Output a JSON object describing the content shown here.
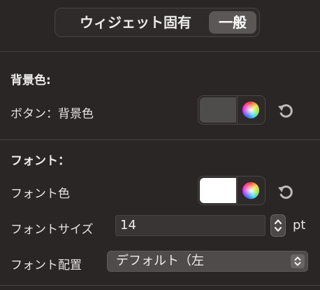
{
  "tabs": {
    "items": [
      {
        "label": "ウィジェット固有",
        "selected": false
      },
      {
        "label": "一般",
        "selected": true
      }
    ]
  },
  "background": {
    "heading": "背景色:",
    "button_bg_label": "ボタン：背景色",
    "button_bg_color": "#4f4c4c"
  },
  "font": {
    "heading": "フォント：",
    "color_label": "フォント色",
    "color_value": "#ffffff",
    "size_label": "フォントサイズ",
    "size_value": "14",
    "size_unit": "pt",
    "align_label": "フォント配置",
    "align_value": "デフォルト（左"
  }
}
